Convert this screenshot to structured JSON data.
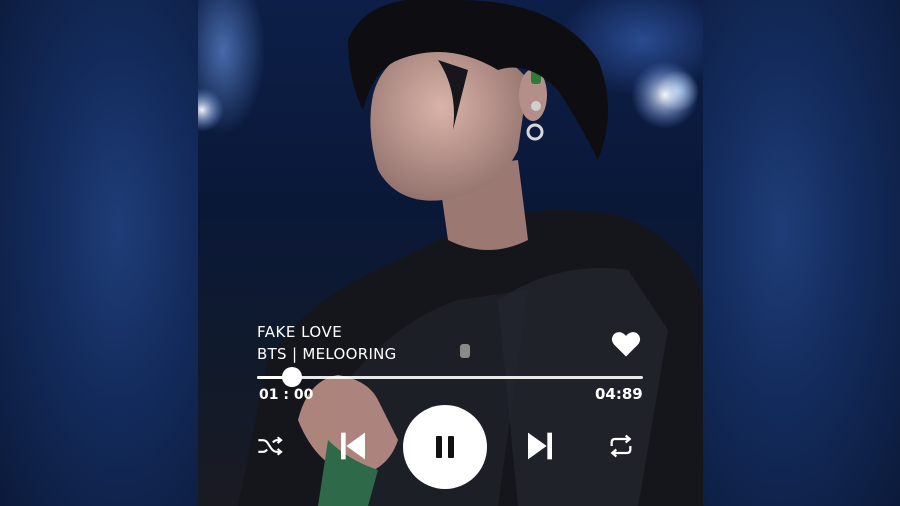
{
  "track": {
    "title": "FAKE LOVE",
    "artist": "BTS | MELOORING",
    "current_time": "01 : 00",
    "total_time": "04:89",
    "progress_fraction": 0.09
  },
  "controls": {
    "shuffle_icon": "shuffle-icon",
    "previous_icon": "skip-previous-icon",
    "play_state_icon": "pause-icon",
    "next_icon": "skip-next-icon",
    "repeat_icon": "repeat-icon",
    "favorite_icon": "heart-icon"
  },
  "colors": {
    "text": "#ffffff",
    "background": "#0b1a3a",
    "button": "#ffffff"
  }
}
